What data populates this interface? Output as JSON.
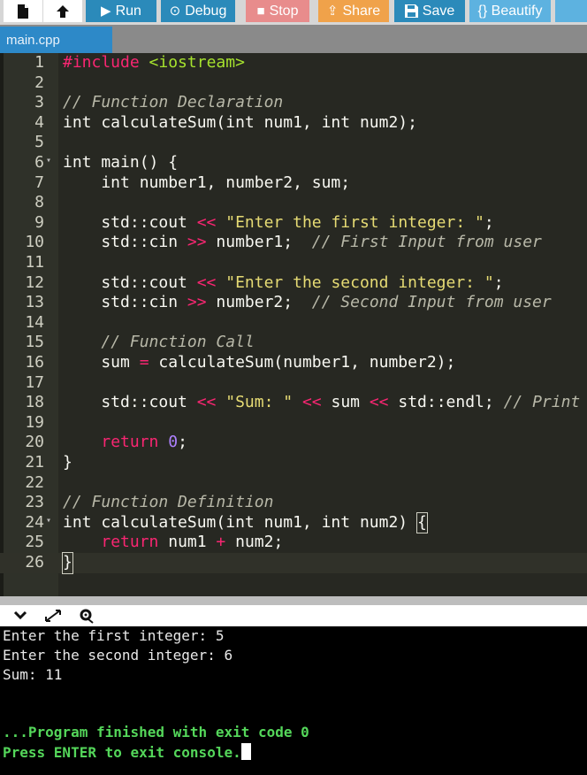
{
  "toolbar": {
    "run_label": "Run",
    "debug_label": "Debug",
    "stop_label": "Stop",
    "share_label": "Share",
    "save_label": "Save",
    "beautify_label": "{} Beautify"
  },
  "tab": {
    "name": "main.cpp"
  },
  "editor": {
    "lines": [
      {
        "n": "1",
        "parts": [
          [
            "pp",
            "#include "
          ],
          [
            "inc",
            "<iostream>"
          ]
        ]
      },
      {
        "n": "2",
        "parts": []
      },
      {
        "n": "3",
        "parts": [
          [
            "cm",
            "// Function Declaration"
          ]
        ]
      },
      {
        "n": "4",
        "parts": [
          [
            "id",
            "int calculateSum(int num1, int num2);"
          ]
        ]
      },
      {
        "n": "5",
        "parts": []
      },
      {
        "n": "6",
        "fold": true,
        "parts": [
          [
            "id",
            "int main() {"
          ]
        ]
      },
      {
        "n": "7",
        "parts": [
          [
            "id",
            "    int number1, number2, sum;"
          ]
        ]
      },
      {
        "n": "8",
        "parts": []
      },
      {
        "n": "9",
        "parts": [
          [
            "id",
            "    std::cout "
          ],
          [
            "op",
            "<<"
          ],
          [
            "id",
            " "
          ],
          [
            "str",
            "\"Enter the first integer: \""
          ],
          [
            "id",
            ";"
          ]
        ]
      },
      {
        "n": "10",
        "parts": [
          [
            "id",
            "    std::cin "
          ],
          [
            "op",
            ">>"
          ],
          [
            "id",
            " number1;  "
          ],
          [
            "cm",
            "// First Input from user"
          ]
        ]
      },
      {
        "n": "11",
        "parts": []
      },
      {
        "n": "12",
        "parts": [
          [
            "id",
            "    std::cout "
          ],
          [
            "op",
            "<<"
          ],
          [
            "id",
            " "
          ],
          [
            "str",
            "\"Enter the second integer: \""
          ],
          [
            "id",
            ";"
          ]
        ]
      },
      {
        "n": "13",
        "parts": [
          [
            "id",
            "    std::cin "
          ],
          [
            "op",
            ">>"
          ],
          [
            "id",
            " number2;  "
          ],
          [
            "cm",
            "// Second Input from user"
          ]
        ]
      },
      {
        "n": "14",
        "parts": []
      },
      {
        "n": "15",
        "parts": [
          [
            "id",
            "    "
          ],
          [
            "cm",
            "// Function Call"
          ]
        ]
      },
      {
        "n": "16",
        "parts": [
          [
            "id",
            "    sum "
          ],
          [
            "op",
            "="
          ],
          [
            "id",
            " calculateSum(number1, number2);"
          ]
        ]
      },
      {
        "n": "17",
        "parts": []
      },
      {
        "n": "18",
        "parts": [
          [
            "id",
            "    std::cout "
          ],
          [
            "op",
            "<<"
          ],
          [
            "id",
            " "
          ],
          [
            "str",
            "\"Sum: \""
          ],
          [
            "id",
            " "
          ],
          [
            "op",
            "<<"
          ],
          [
            "id",
            " sum "
          ],
          [
            "op",
            "<<"
          ],
          [
            "id",
            " std::endl; "
          ],
          [
            "cm",
            "// Print"
          ]
        ]
      },
      {
        "n": "19",
        "parts": []
      },
      {
        "n": "20",
        "parts": [
          [
            "id",
            "    "
          ],
          [
            "kw",
            "return"
          ],
          [
            "id",
            " "
          ],
          [
            "num",
            "0"
          ],
          [
            "id",
            ";"
          ]
        ]
      },
      {
        "n": "21",
        "parts": [
          [
            "id",
            "}"
          ]
        ]
      },
      {
        "n": "22",
        "parts": []
      },
      {
        "n": "23",
        "parts": [
          [
            "cm",
            "// Function Definition"
          ]
        ]
      },
      {
        "n": "24",
        "fold": true,
        "parts": [
          [
            "id",
            "int calculateSum(int num1, int num2) "
          ],
          [
            "cur",
            "{"
          ]
        ]
      },
      {
        "n": "25",
        "parts": [
          [
            "id",
            "    "
          ],
          [
            "kw",
            "return"
          ],
          [
            "id",
            " num1 "
          ],
          [
            "op",
            "+"
          ],
          [
            "id",
            " num2;"
          ]
        ]
      },
      {
        "n": "26",
        "active": true,
        "parts": [
          [
            "cur",
            "}"
          ]
        ]
      }
    ]
  },
  "console": {
    "lines": [
      {
        "text": "Enter the first integer: 5",
        "style": "normal"
      },
      {
        "text": "Enter the second integer: 6",
        "style": "normal"
      },
      {
        "text": "Sum: 11",
        "style": "normal"
      },
      {
        "text": "...Program finished with exit code 0",
        "style": "green"
      },
      {
        "text": "Press ENTER to exit console.",
        "style": "green",
        "cursor": true
      }
    ]
  },
  "colors": {
    "run": "#2b8aba",
    "stop": "#e88c8c",
    "share": "#f0a24a",
    "beautify": "#5db2e0",
    "editor_bg": "#272822",
    "console_green": "#54d65a"
  }
}
